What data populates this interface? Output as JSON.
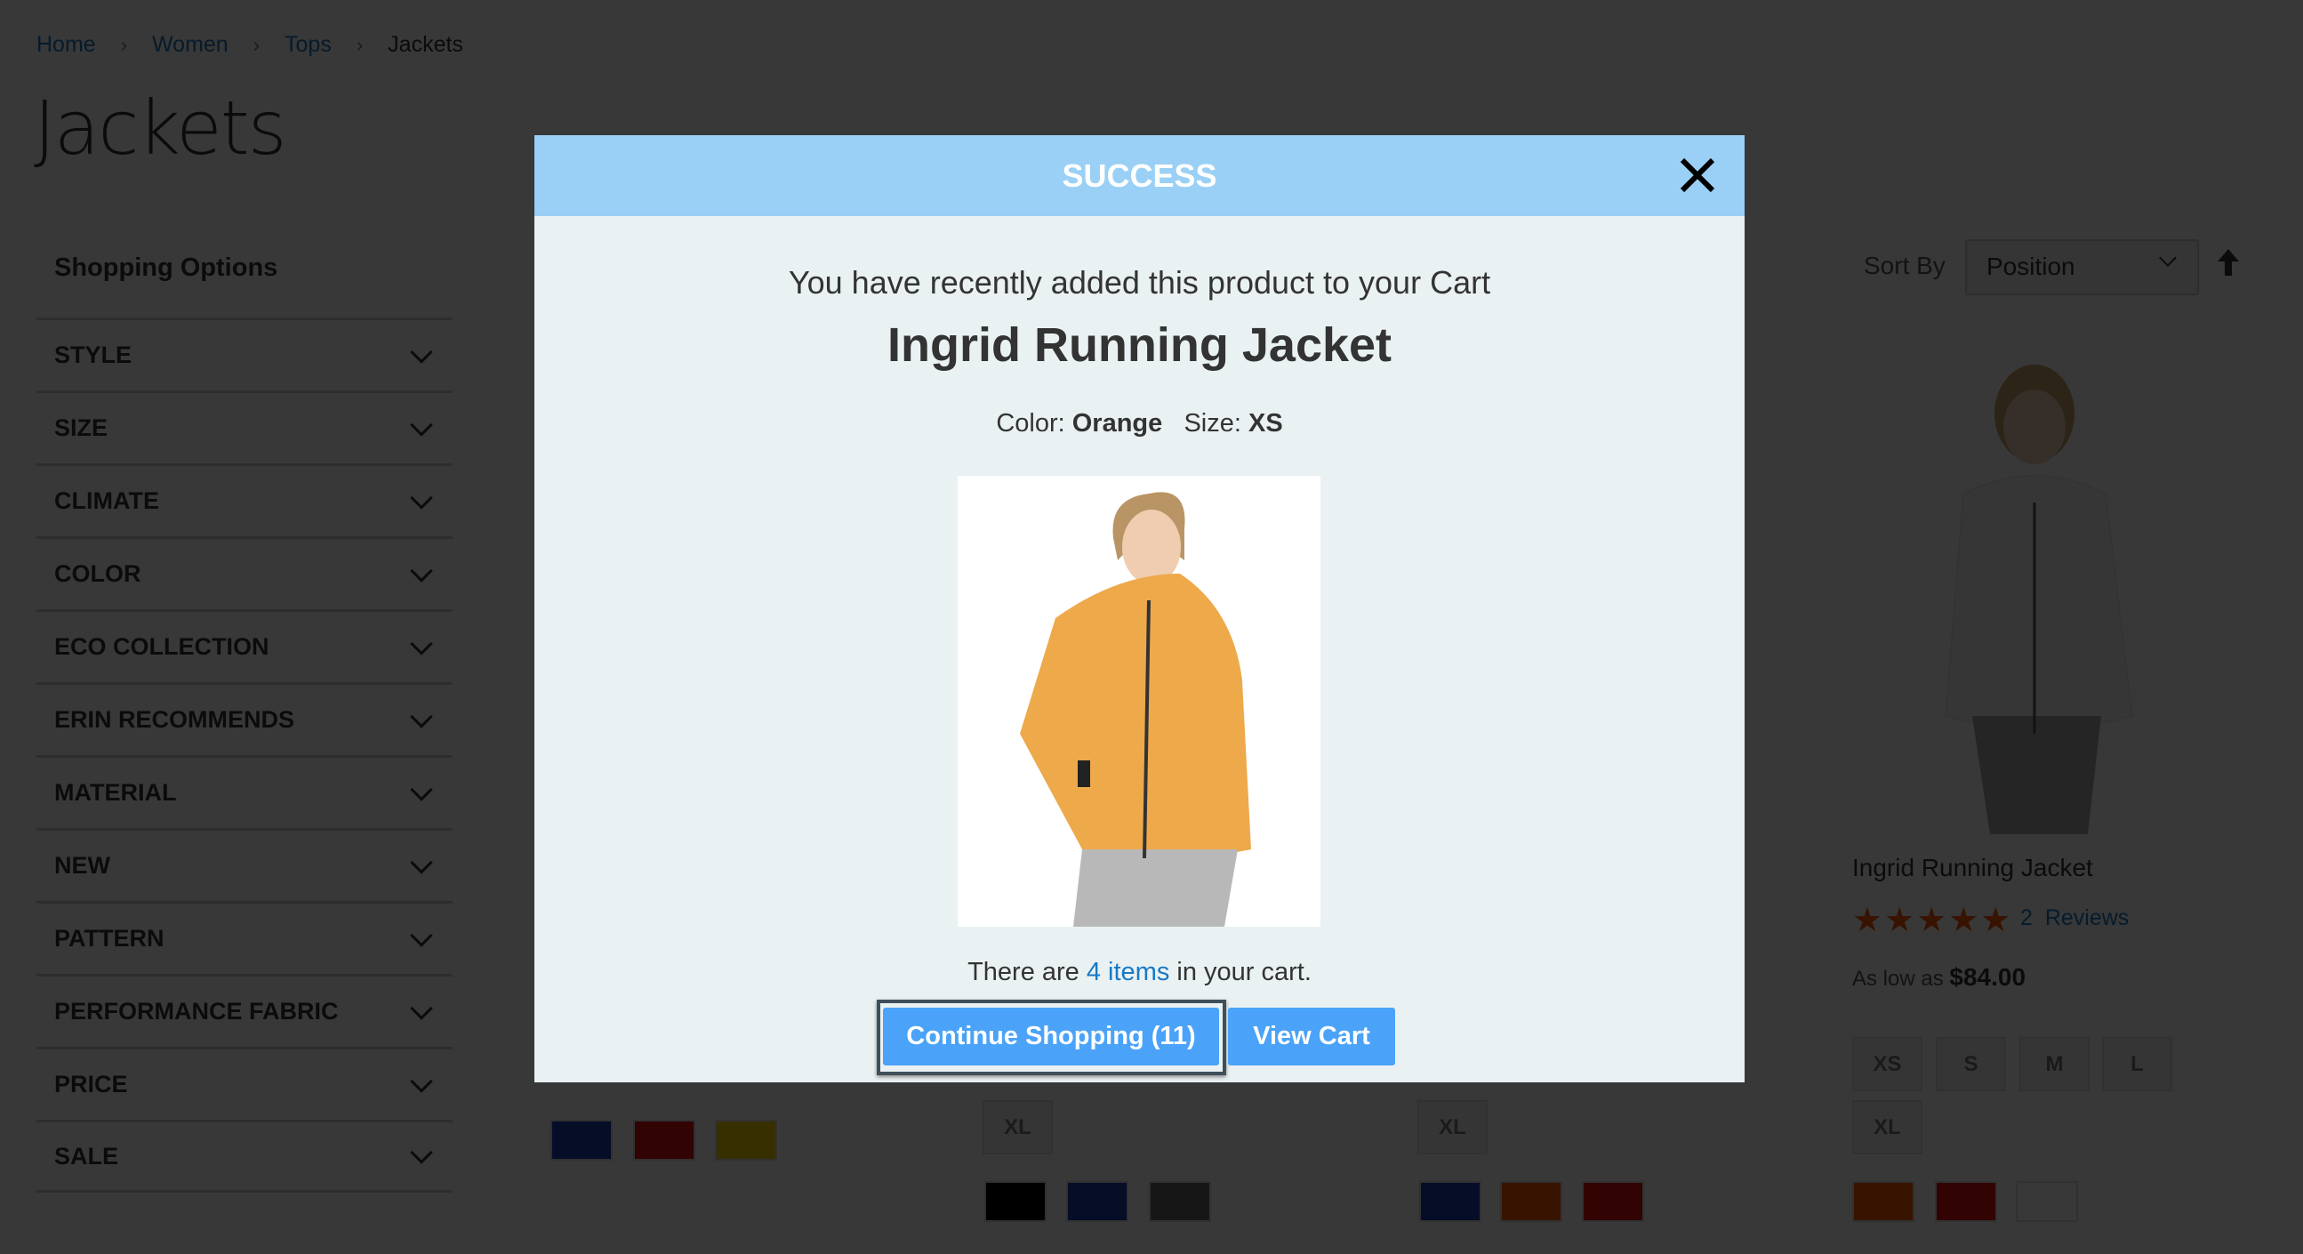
{
  "breadcrumb": [
    {
      "label": "Home"
    },
    {
      "label": "Women"
    },
    {
      "label": "Tops"
    },
    {
      "label": "Jackets"
    }
  ],
  "breadcrumb_separator": "›",
  "page_title": "Jackets",
  "sidebar": {
    "title": "Shopping Options",
    "filters": [
      {
        "label": "STYLE"
      },
      {
        "label": "SIZE"
      },
      {
        "label": "CLIMATE"
      },
      {
        "label": "COLOR"
      },
      {
        "label": "ECO COLLECTION"
      },
      {
        "label": "ERIN RECOMMENDS"
      },
      {
        "label": "MATERIAL"
      },
      {
        "label": "NEW"
      },
      {
        "label": "PATTERN"
      },
      {
        "label": "PERFORMANCE FABRIC"
      },
      {
        "label": "PRICE"
      },
      {
        "label": "SALE"
      }
    ]
  },
  "toolbar": {
    "sort_label": "Sort By",
    "sort_value": "Position",
    "sort_direction_icon": "arrow-up-icon"
  },
  "product": {
    "name": "Ingrid Running Jacket",
    "rating_stars": 4.5,
    "rating_max": 5,
    "stars_text": "★★★★★",
    "reviews_count": "2",
    "reviews_label": "Reviews",
    "price_prefix": "As low as",
    "price": "$84.00",
    "sizes": [
      "XS",
      "S",
      "M",
      "L",
      "XL"
    ],
    "swatches": [
      "#ff5501",
      "#e0140e",
      "#ffffff"
    ]
  },
  "other_products": [
    {
      "sizes_extra": "",
      "swatches": [
        "#1a3ab0",
        "#e0140e",
        "#ffd700"
      ]
    },
    {
      "sizes_extra": "XL",
      "swatches": [
        "#000000",
        "#1a3ab0",
        "#666666"
      ]
    },
    {
      "sizes_extra": "XL",
      "swatches": [
        "#1a3ab0",
        "#ff5501",
        "#e0140e"
      ]
    }
  ],
  "modal": {
    "title": "SUCCESS",
    "close_icon": "close-icon",
    "message": "You have recently added this product to your Cart",
    "product_name": "Ingrid Running Jacket",
    "color_label": "Color:",
    "color_value": "Orange",
    "size_label": "Size:",
    "size_value": "XS",
    "cart_pre": "There are",
    "cart_link": "4 items",
    "cart_post": "in your cart.",
    "continue_label": "Continue Shopping (11)",
    "view_cart_label": "View Cart"
  },
  "colors": {
    "accent": "#4aa3f8",
    "header": "#9ad0f5",
    "link": "#1979c3",
    "star": "#ff5501"
  }
}
